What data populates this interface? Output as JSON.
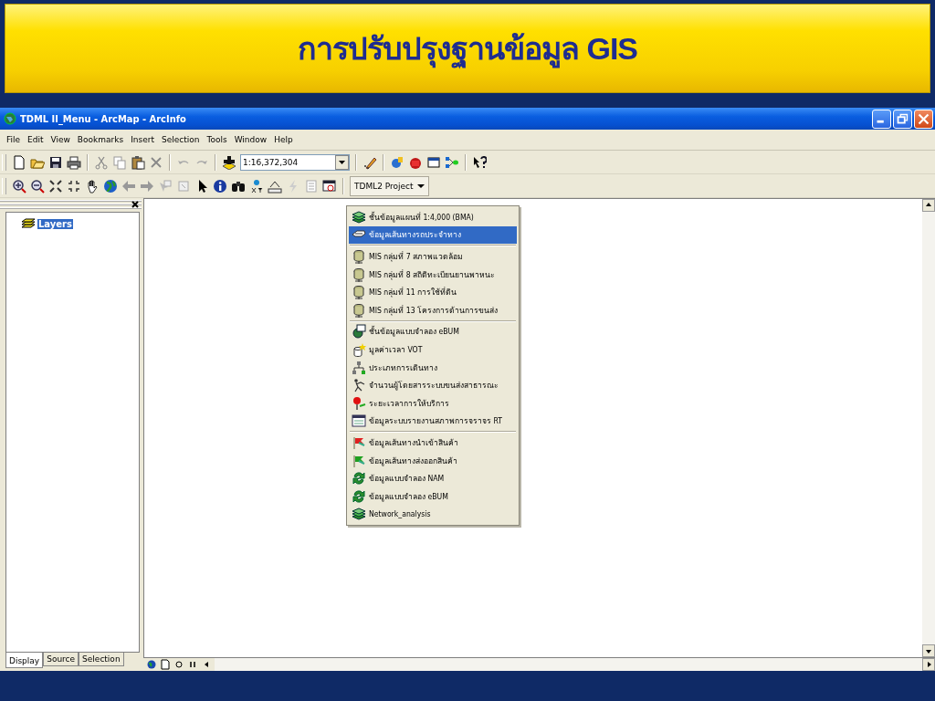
{
  "slide": {
    "title": "การปรับปรุงฐานข้อมูล GIS"
  },
  "window": {
    "title": "TDML II_Menu - ArcMap - ArcInfo"
  },
  "menu_bar": [
    "File",
    "Edit",
    "View",
    "Bookmarks",
    "Insert",
    "Selection",
    "Tools",
    "Window",
    "Help"
  ],
  "scale_field": {
    "value": "1:16,372,304"
  },
  "project_menu": {
    "label": "TDML2 Project",
    "expanded": true,
    "groups": [
      [
        {
          "label": "ชั้นข้อมูลแผนที่ 1:4,000 (BMA)",
          "selected": false
        },
        {
          "label": "ข้อมูลเส้นทางรถประจำทาง",
          "selected": true
        }
      ],
      [
        {
          "label": "MIS กลุ่มที่ 7 สภาพแวดล้อม",
          "selected": false
        },
        {
          "label": "MIS กลุ่มที่ 8 สถิติทะเบียนยานพาหนะ",
          "selected": false
        },
        {
          "label": "MIS กลุ่มที่ 11 การใช้ที่ดิน",
          "selected": false
        },
        {
          "label": "MIS กลุ่มที่ 13 โครงการด้านการขนส่ง",
          "selected": false
        }
      ],
      [
        {
          "label": "ชั้นข้อมูลแบบจำลอง eBUM",
          "selected": false
        },
        {
          "label": "มูลค่าเวลา VOT",
          "selected": false
        },
        {
          "label": "ประเภทการเดินทาง",
          "selected": false
        },
        {
          "label": "จำนวนผู้โดยสารระบบขนส่งสาธารณะ",
          "selected": false
        },
        {
          "label": "ระยะเวลาการให้บริการ",
          "selected": false
        },
        {
          "label": "ข้อมูลระบบรายงานสภาพการจราจร RT",
          "selected": false
        }
      ],
      [
        {
          "label": "ข้อมูลเส้นทางนำเข้าสินค้า",
          "selected": false
        },
        {
          "label": "ข้อมูลเส้นทางส่งออกสินค้า",
          "selected": false
        },
        {
          "label": "ข้อมูลแบบจำลอง NAM",
          "selected": false
        },
        {
          "label": "ข้อมูลแบบจำลอง eBUM",
          "selected": false
        },
        {
          "label": "Network_analysis",
          "selected": false
        }
      ]
    ]
  },
  "toc": {
    "items": [
      {
        "label": "Layers",
        "selected": true
      }
    ],
    "tabs": [
      {
        "label": "Display",
        "selected": true
      },
      {
        "label": "Source",
        "selected": false
      },
      {
        "label": "Selection",
        "selected": false
      }
    ]
  }
}
